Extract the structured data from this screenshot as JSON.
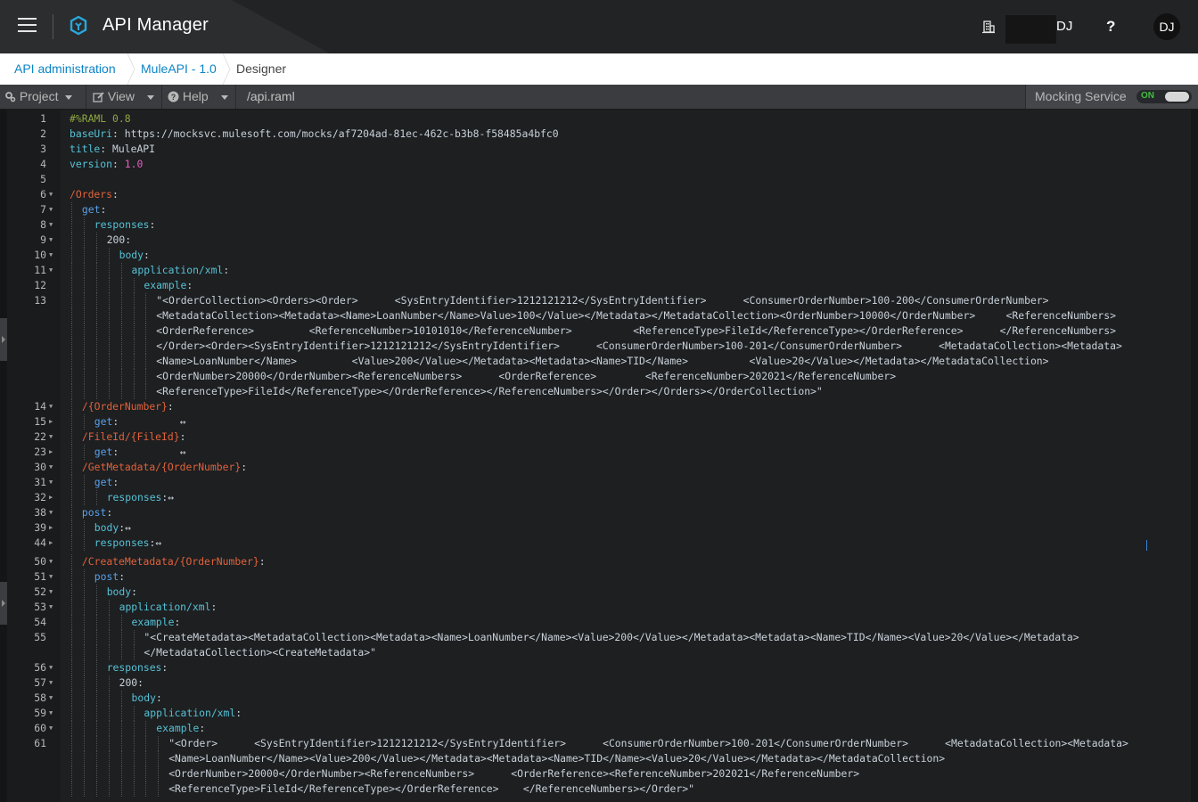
{
  "header": {
    "app_title": "API Manager",
    "user_initials": "DJ",
    "help_label": "?",
    "avatar_initials": "DJ"
  },
  "breadcrumb": {
    "items": [
      "API administration",
      "MuleAPI - 1.0",
      "Designer"
    ]
  },
  "toolbar": {
    "project_label": "Project",
    "view_label": "View",
    "help_label": "Help",
    "file_name": "/api.raml",
    "mocking_label": "Mocking Service",
    "mocking_toggle": "ON"
  },
  "colors": {
    "key": "#56c2d6",
    "method": "#5aa0e6",
    "resource": "#e0623a",
    "number": "#e95dbf",
    "comment": "#8fa640",
    "link": "#0b84c6"
  },
  "editor": {
    "lines": [
      {
        "n": "1",
        "fold": false,
        "indent": 0,
        "spans": [
          [
            "c",
            "#%RAML 0.8"
          ]
        ]
      },
      {
        "n": "2",
        "fold": false,
        "indent": 0,
        "spans": [
          [
            "k",
            "baseUri"
          ],
          [
            "s",
            ": https://mocksvc.mulesoft.com/mocks/af7204ad-81ec-462c-b3b8-f58485a4bfc0"
          ]
        ]
      },
      {
        "n": "3",
        "fold": false,
        "indent": 0,
        "spans": [
          [
            "k",
            "title"
          ],
          [
            "s",
            ": MuleAPI"
          ]
        ]
      },
      {
        "n": "4",
        "fold": false,
        "indent": 0,
        "spans": [
          [
            "k",
            "version"
          ],
          [
            "s",
            ": "
          ],
          [
            "n",
            "1.0"
          ]
        ]
      },
      {
        "n": "5",
        "fold": false,
        "indent": 0,
        "spans": []
      },
      {
        "n": "6",
        "fold": true,
        "indent": 0,
        "spans": [
          [
            "r",
            "/Orders"
          ],
          [
            "s",
            ":"
          ]
        ]
      },
      {
        "n": "7",
        "fold": true,
        "indent": 1,
        "spans": [
          [
            "kb",
            "get"
          ],
          [
            "s",
            ":"
          ]
        ]
      },
      {
        "n": "8",
        "fold": true,
        "indent": 2,
        "spans": [
          [
            "k",
            "responses"
          ],
          [
            "s",
            ":"
          ]
        ]
      },
      {
        "n": "9",
        "fold": true,
        "indent": 3,
        "spans": [
          [
            "s",
            "200:"
          ]
        ]
      },
      {
        "n": "10",
        "fold": true,
        "indent": 4,
        "spans": [
          [
            "k",
            "body"
          ],
          [
            "s",
            ":"
          ]
        ]
      },
      {
        "n": "11",
        "fold": true,
        "indent": 5,
        "spans": [
          [
            "k",
            "application/xml"
          ],
          [
            "s",
            ":"
          ]
        ]
      },
      {
        "n": "12",
        "fold": false,
        "indent": 6,
        "spans": [
          [
            "k",
            "example"
          ],
          [
            "s",
            ":"
          ]
        ]
      },
      {
        "n": "13",
        "fold": false,
        "indent": 7,
        "spans": [
          [
            "s",
            "\"<OrderCollection><Orders><Order>      <SysEntryIdentifier>1212121212</SysEntryIdentifier>      <ConsumerOrderNumber>100-200</ConsumerOrderNumber>"
          ]
        ]
      },
      {
        "n": "",
        "fold": false,
        "indent": 7,
        "spans": [
          [
            "s",
            "<MetadataCollection><Metadata><Name>LoanNumber</Name>Value>100</Value></Metadata></MetadataCollection><OrderNumber>10000</OrderNumber>     <ReferenceNumbers>"
          ]
        ]
      },
      {
        "n": "",
        "fold": false,
        "indent": 7,
        "spans": [
          [
            "s",
            "<OrderReference>         <ReferenceNumber>10101010</ReferenceNumber>          <ReferenceType>FileId</ReferenceType></OrderReference>      </ReferenceNumbers>"
          ]
        ]
      },
      {
        "n": "",
        "fold": false,
        "indent": 7,
        "spans": [
          [
            "s",
            "</Order><Order><SysEntryIdentifier>1212121212</SysEntryIdentifier>      <ConsumerOrderNumber>100-201</ConsumerOrderNumber>      <MetadataCollection><Metadata>"
          ]
        ]
      },
      {
        "n": "",
        "fold": false,
        "indent": 7,
        "spans": [
          [
            "s",
            "<Name>LoanNumber</Name>         <Value>200</Value></Metadata><Metadata><Name>TID</Name>          <Value>20</Value></Metadata></MetadataCollection>"
          ]
        ]
      },
      {
        "n": "",
        "fold": false,
        "indent": 7,
        "spans": [
          [
            "s",
            "<OrderNumber>20000</OrderNumber><ReferenceNumbers>      <OrderReference>        <ReferenceNumber>202021</ReferenceNumber>"
          ]
        ]
      },
      {
        "n": "",
        "fold": false,
        "indent": 7,
        "spans": [
          [
            "s",
            "<ReferenceType>FileId</ReferenceType></OrderReference></ReferenceNumbers></Order></Orders></OrderCollection>\""
          ]
        ]
      },
      {
        "n": "14",
        "fold": true,
        "indent": 1,
        "spans": [
          [
            "r",
            "/{OrderNumber}"
          ],
          [
            "s",
            ":"
          ]
        ]
      },
      {
        "n": "15",
        "fold": false,
        "indent": 2,
        "collapsed": true,
        "spans": [
          [
            "kb",
            "get"
          ],
          [
            "s",
            ":          ↔"
          ]
        ]
      },
      {
        "n": "22",
        "fold": true,
        "indent": 1,
        "spans": [
          [
            "r",
            "/FileId/{FileId}"
          ],
          [
            "s",
            ":"
          ]
        ]
      },
      {
        "n": "23",
        "fold": false,
        "indent": 2,
        "collapsed": true,
        "spans": [
          [
            "kb",
            "get"
          ],
          [
            "s",
            ":          ↔"
          ]
        ]
      },
      {
        "n": "30",
        "fold": true,
        "indent": 1,
        "spans": [
          [
            "r",
            "/GetMetadata/{OrderNumber}"
          ],
          [
            "s",
            ":"
          ]
        ]
      },
      {
        "n": "31",
        "fold": true,
        "indent": 2,
        "spans": [
          [
            "kb",
            "get"
          ],
          [
            "s",
            ":"
          ]
        ]
      },
      {
        "n": "32",
        "fold": false,
        "indent": 3,
        "collapsed": true,
        "spans": [
          [
            "k",
            "responses"
          ],
          [
            "s",
            ":↔"
          ]
        ]
      },
      {
        "n": "38",
        "fold": true,
        "indent": 1,
        "spans": [
          [
            "kb",
            "post"
          ],
          [
            "s",
            ":"
          ]
        ]
      },
      {
        "n": "39",
        "fold": false,
        "indent": 2,
        "collapsed": true,
        "spans": [
          [
            "k",
            "body"
          ],
          [
            "s",
            ":↔"
          ]
        ]
      },
      {
        "n": "44",
        "fold": false,
        "indent": 2,
        "collapsed": true,
        "spans": [
          [
            "k",
            "responses"
          ],
          [
            "s",
            ":↔"
          ]
        ]
      },
      {
        "n": "50",
        "fold": true,
        "indent": 1,
        "gap": 4,
        "spans": [
          [
            "r",
            "/CreateMetadata/{OrderNumber}"
          ],
          [
            "s",
            ":"
          ]
        ]
      },
      {
        "n": "51",
        "fold": true,
        "indent": 2,
        "spans": [
          [
            "kb",
            "post"
          ],
          [
            "s",
            ":"
          ]
        ]
      },
      {
        "n": "52",
        "fold": true,
        "indent": 3,
        "spans": [
          [
            "k",
            "body"
          ],
          [
            "s",
            ":"
          ]
        ]
      },
      {
        "n": "53",
        "fold": true,
        "indent": 4,
        "spans": [
          [
            "k",
            "application/xml"
          ],
          [
            "s",
            ":"
          ]
        ]
      },
      {
        "n": "54",
        "fold": false,
        "indent": 5,
        "spans": [
          [
            "k",
            "example"
          ],
          [
            "s",
            ":"
          ]
        ]
      },
      {
        "n": "55",
        "fold": false,
        "indent": 6,
        "spans": [
          [
            "s",
            "\"<CreateMetadata><MetadataCollection><Metadata><Name>LoanNumber</Name><Value>200</Value></Metadata><Metadata><Name>TID</Name><Value>20</Value></Metadata>"
          ]
        ]
      },
      {
        "n": "",
        "fold": false,
        "indent": 6,
        "spans": [
          [
            "s",
            "</MetadataCollection><CreateMetadata>\""
          ]
        ]
      },
      {
        "n": "56",
        "fold": true,
        "indent": 3,
        "spans": [
          [
            "k",
            "responses"
          ],
          [
            "s",
            ":"
          ]
        ]
      },
      {
        "n": "57",
        "fold": true,
        "indent": 4,
        "spans": [
          [
            "s",
            "200:"
          ]
        ]
      },
      {
        "n": "58",
        "fold": true,
        "indent": 5,
        "spans": [
          [
            "k",
            "body"
          ],
          [
            "s",
            ":"
          ]
        ]
      },
      {
        "n": "59",
        "fold": true,
        "indent": 6,
        "spans": [
          [
            "k",
            "application/xml"
          ],
          [
            "s",
            ":"
          ]
        ]
      },
      {
        "n": "60",
        "fold": true,
        "indent": 7,
        "spans": [
          [
            "k",
            "example"
          ],
          [
            "s",
            ":"
          ]
        ]
      },
      {
        "n": "61",
        "fold": false,
        "indent": 8,
        "spans": [
          [
            "s",
            "\"<Order>      <SysEntryIdentifier>1212121212</SysEntryIdentifier>      <ConsumerOrderNumber>100-201</ConsumerOrderNumber>      <MetadataCollection><Metadata>"
          ]
        ]
      },
      {
        "n": "",
        "fold": false,
        "indent": 8,
        "spans": [
          [
            "s",
            "<Name>LoanNumber</Name><Value>200</Value></Metadata><Metadata><Name>TID</Name><Value>20</Value></Metadata></MetadataCollection>"
          ]
        ]
      },
      {
        "n": "",
        "fold": false,
        "indent": 8,
        "spans": [
          [
            "s",
            "<OrderNumber>20000</OrderNumber><ReferenceNumbers>      <OrderReference><ReferenceNumber>202021</ReferenceNumber>"
          ]
        ]
      },
      {
        "n": "",
        "fold": false,
        "indent": 8,
        "spans": [
          [
            "s",
            "<ReferenceType>FileId</ReferenceType></OrderReference>    </ReferenceNumbers></Order>\""
          ]
        ]
      }
    ]
  }
}
